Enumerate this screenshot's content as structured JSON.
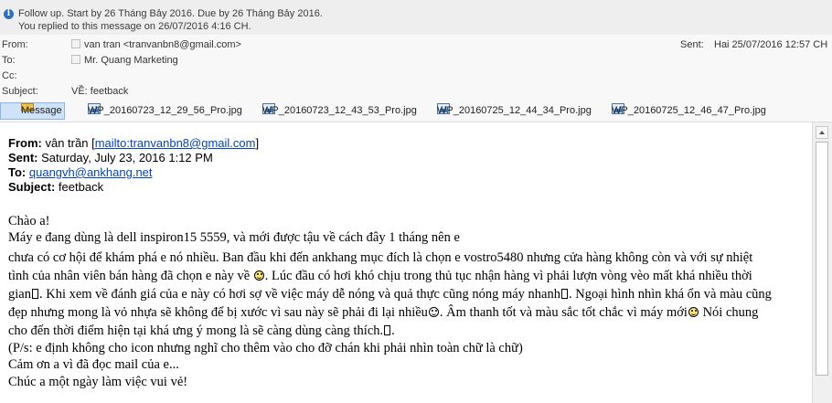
{
  "infobar": {
    "icon": "info-icon",
    "line1": "Follow up.  Start by 26 Tháng Bảy 2016.  Due by 26 Tháng Bảy 2016.",
    "line2": "You replied to this message on 26/07/2016 4:16 CH."
  },
  "header": {
    "from_label": "From:",
    "from_value": "van tran <tranvanbn8@gmail.com>",
    "to_label": "To:",
    "to_value": "Mr. Quang Marketing",
    "cc_label": "Cc:",
    "cc_value": "",
    "subject_label": "Subject:",
    "subject_value": "VỀ: feetback",
    "sent_label": "Sent:",
    "sent_value": "Hai 25/07/2016 12:57 CH"
  },
  "attachments": {
    "message_tab": "Message",
    "files": [
      "WP_20160723_12_29_56_Pro.jpg",
      "WP_20160723_12_43_53_Pro.jpg",
      "WP_20160725_12_44_34_Pro.jpg",
      "WP_20160725_12_46_47_Pro.jpg"
    ]
  },
  "quoted": {
    "from_label": "From:",
    "from_name": "vân trần",
    "from_link": "mailto:tranvanbn8@gmail.com",
    "sent_label": "Sent:",
    "sent_value": "Saturday, July 23, 2016 1:12 PM",
    "to_label": "To:",
    "to_value": "quangvh@ankhang.net",
    "subject_label": "Subject:",
    "subject_value": "feetback"
  },
  "body": {
    "greeting": "Chào a!",
    "line1": "Máy e đang dùng là dell inspiron15 5559, và mới được tậu về cách đây 1 tháng nên e",
    "line2": "chưa có cơ hội để khám phá e nó nhiều. Ban đầu khi đến ankhang mục đích là chọn e vostro5480 nhưng cửa hàng không còn và với sự nhiệt",
    "line3a": "tình của nhân viên bán hàng đã chọn e này về",
    "line3b": ". Lúc đầu có hơi khó chịu trong thủ tục nhận hàng vì phải lượn vòng vèo mất khá nhiều thời",
    "line4a": "gian",
    "line4b": ". Khi xem về đánh giá của e này có hơi sợ về việc máy dễ nóng và quả thực cũng nóng máy nhanh",
    "line4c": ". Ngoại hình nhìn khá ổn và màu cũng",
    "line5a": "đẹp nhưng mong là vỏ nhựa sẽ không để bị xước vì sau này sẽ phải đi lại nhiều",
    "line5b": ". Âm thanh tốt và màu sắc tốt chắc vì máy mới",
    "line5c": " Nói chung",
    "line6a": "cho đến thời điểm hiện tại khá ưng ý mong là sẽ càng dùng càng thích.",
    "line6b": ".",
    "line7": "(P/s: e định không cho icon nhưng nghĩ cho thêm vào cho đỡ chán khi phải nhìn toàn chữ là chữ)",
    "line8": "Cảm ơn a vì đã đọc mail của e...",
    "line9": "Chúc a một ngày làm việc vui vẻ!"
  }
}
